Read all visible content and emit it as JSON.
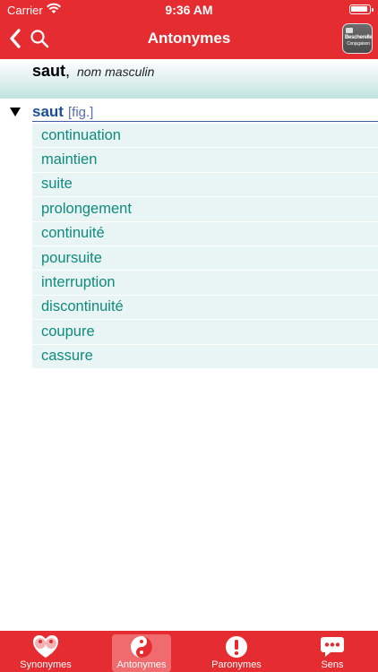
{
  "status": {
    "carrier": "Carrier",
    "time": "9:36 AM"
  },
  "nav": {
    "title": "Antonymes",
    "app_badge_line1": "Bescherelle",
    "app_badge_line2": "Conjugaison"
  },
  "entry": {
    "word": "saut",
    "comma": ",",
    "pos": "nom masculin"
  },
  "section": {
    "word": "saut",
    "tag": "[fig.]"
  },
  "antonyms": [
    "continuation",
    "maintien",
    "suite",
    "prolongement",
    "continuité",
    "poursuite",
    "interruption",
    "discontinuité",
    "coupure",
    "cassure"
  ],
  "tabs": [
    {
      "label": "Synonymes",
      "icon": "synonymes-icon",
      "active": false
    },
    {
      "label": "Antonymes",
      "icon": "yin-yang-icon",
      "active": true
    },
    {
      "label": "Paronymes",
      "icon": "exclamation-icon",
      "active": false
    },
    {
      "label": "Sens",
      "icon": "speech-bubble-icon",
      "active": false
    }
  ],
  "colors": {
    "brand_red": "#e52d31",
    "list_text": "#0f8a7e",
    "list_bg": "#e9f5f4",
    "section_text": "#1b4f95"
  }
}
